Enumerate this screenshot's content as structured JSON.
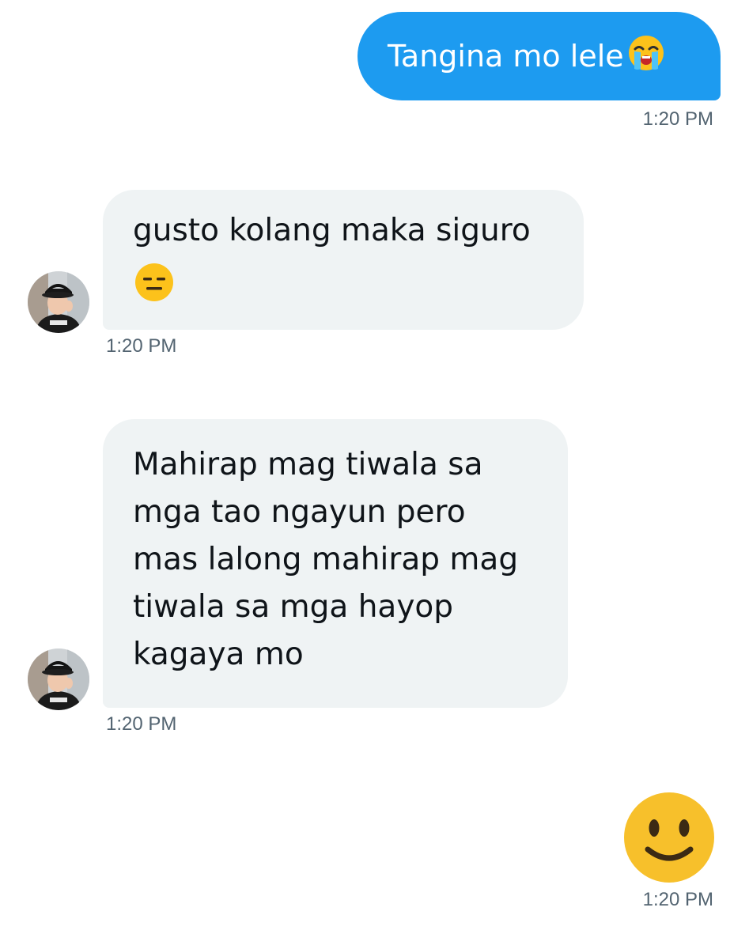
{
  "messages": {
    "out_1": {
      "text": "Tangina mo lele",
      "emoji": "loudly-crying-face",
      "time": "1:20 PM"
    },
    "in_1": {
      "lines": [
        "gusto kolang maka siguro"
      ],
      "emoji": "expressionless-face",
      "time": "1:20 PM"
    },
    "in_2": {
      "lines": [
        "Mahirap mag tiwala sa",
        "mga tao ngayun pero",
        "mas lalong mahirap mag",
        "tiwala sa mga hayop",
        "kagaya mo"
      ],
      "time": "1:20 PM"
    },
    "out_2": {
      "emoji": "slightly-smiling-face",
      "time": "1:20 PM"
    }
  },
  "colors": {
    "outgoing_bubble": "#1d9bf0",
    "incoming_bubble": "#eff3f4",
    "timestamp": "#536471",
    "emoji_yellow": "#f7c02b"
  }
}
